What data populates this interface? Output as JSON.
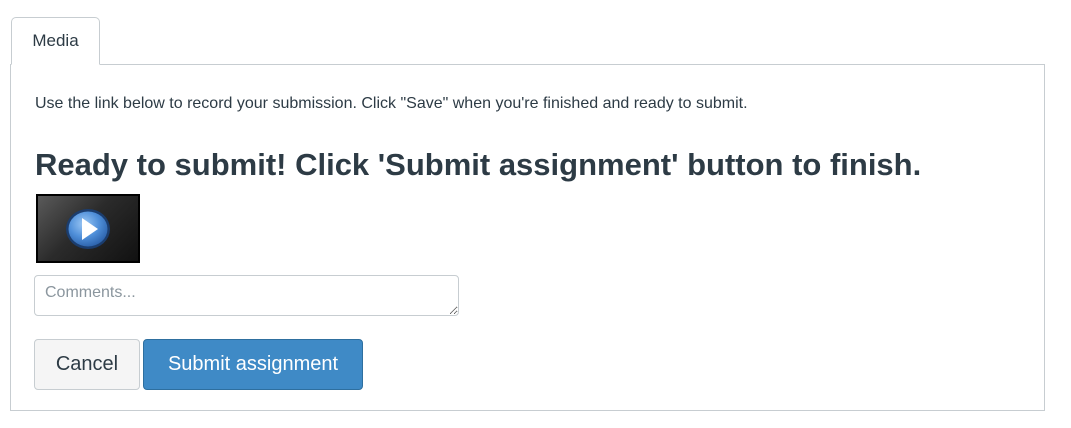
{
  "tab": {
    "label": "Media"
  },
  "content": {
    "instructions": "Use the link below to record your submission. Click \"Save\" when you're finished and ready to submit.",
    "ready_heading": "Ready to submit! Click 'Submit assignment' button to finish.",
    "media_icon": "play-video-icon"
  },
  "comments": {
    "placeholder": "Comments...",
    "value": ""
  },
  "buttons": {
    "cancel_label": "Cancel",
    "submit_label": "Submit assignment"
  },
  "colors": {
    "submit_bg": "#3f8ac6",
    "text": "#2d3b45",
    "border": "#c7cdd1"
  }
}
